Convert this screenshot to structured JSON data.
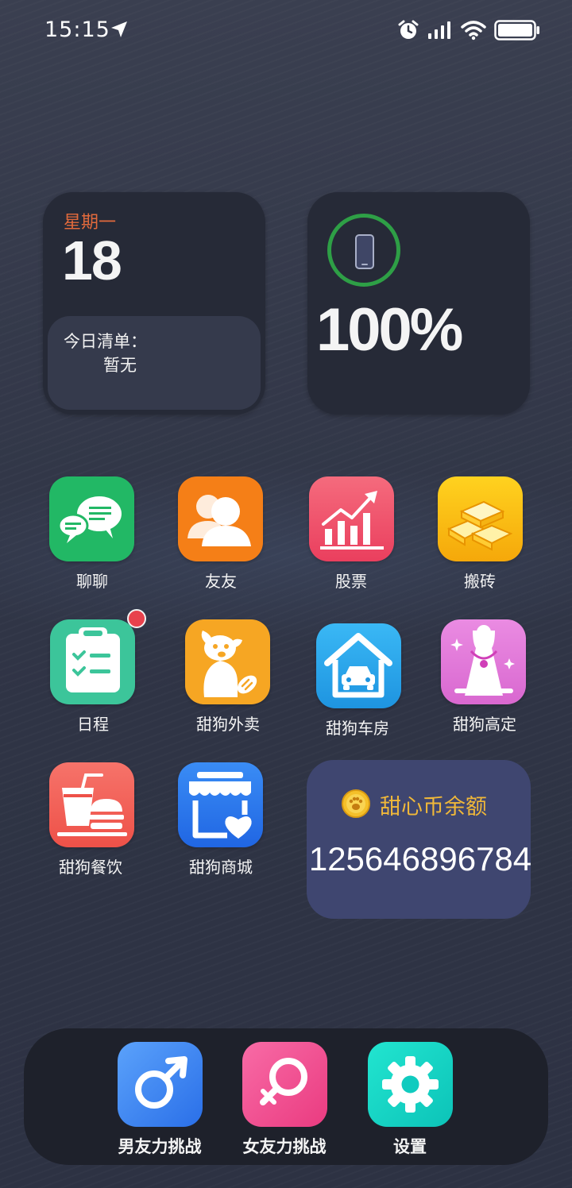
{
  "status_bar": {
    "time": "15:15",
    "icons": [
      "location-arrow-icon",
      "alarm-icon",
      "signal-icon",
      "wifi-icon",
      "battery-icon"
    ]
  },
  "date_widget": {
    "weekday": "星期一",
    "day": "18",
    "todo_label": "今日清单：",
    "todo_value": "暂无"
  },
  "battery_widget": {
    "percent": "100%",
    "icon": "phone-icon",
    "ring_color": "#2e9f46"
  },
  "apps": [
    {
      "label": "聊聊",
      "icon": "chat-bubbles-icon",
      "color": "#22b865"
    },
    {
      "label": "友友",
      "icon": "friends-icon",
      "color": "#f57f17"
    },
    {
      "label": "股票",
      "icon": "stock-chart-icon",
      "color": "#f2566e"
    },
    {
      "label": "搬砖",
      "icon": "gold-bars-icon",
      "color": "#f5b80a"
    },
    {
      "label": "日程",
      "icon": "clipboard-checklist-icon",
      "color": "#3cc59a"
    },
    {
      "label": "甜狗外卖",
      "icon": "dog-bread-icon",
      "color": "#f6a623"
    },
    {
      "label": "甜狗车房",
      "icon": "house-car-icon",
      "color": "#2aa9ec"
    },
    {
      "label": "甜狗高定",
      "icon": "necklace-icon",
      "color": "#e77ad8"
    },
    {
      "label": "甜狗餐饮",
      "icon": "drink-burger-icon",
      "color": "#f2655b"
    },
    {
      "label": "甜狗商城",
      "icon": "shop-heart-icon",
      "color": "#2e7df0"
    }
  ],
  "coin_widget": {
    "title": "甜心币余额",
    "amount": "125646896784",
    "icon": "paw-coin-icon",
    "title_color": "#f0b839"
  },
  "dock": [
    {
      "label": "男友力挑战",
      "icon": "male-symbol-icon",
      "color": "#3f86f2"
    },
    {
      "label": "女友力挑战",
      "icon": "female-symbol-icon",
      "color": "#f04a8c"
    },
    {
      "label": "设置",
      "icon": "gear-icon",
      "color": "#14d3c5"
    }
  ]
}
